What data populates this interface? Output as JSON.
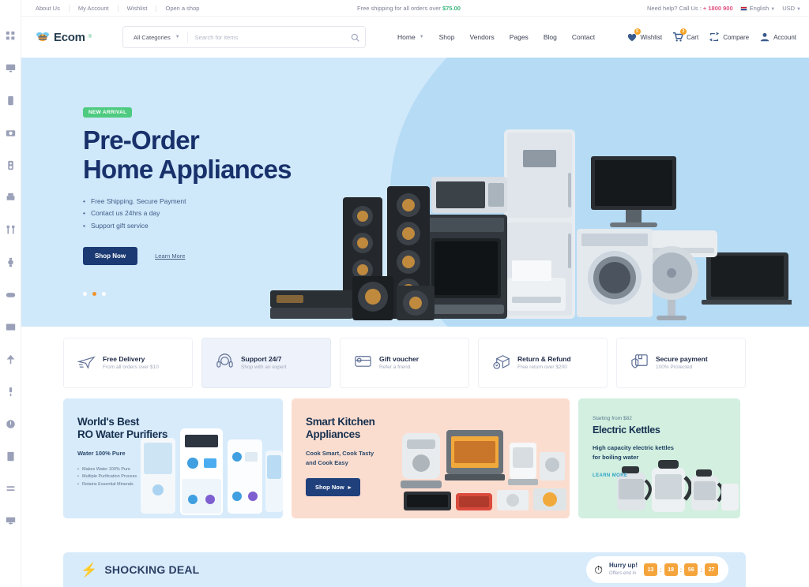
{
  "topbar": {
    "links": [
      "About Us",
      "My Account",
      "Wishlist",
      "Open a shop"
    ],
    "shipping_text": "Free shipping for all orders over ",
    "shipping_amount": "$75.00",
    "help_text": "Need help? Call Us : ",
    "phone": "+ 1800 900",
    "language": "English",
    "currency": "USD"
  },
  "header": {
    "logo_text": "Ecom",
    "logo_sup": "®",
    "search": {
      "category": "All Categories",
      "placeholder": "Search for items",
      "value": ""
    },
    "nav": [
      {
        "label": "Home",
        "has_dropdown": true
      },
      {
        "label": "Shop",
        "has_dropdown": false
      },
      {
        "label": "Vendors",
        "has_dropdown": false
      },
      {
        "label": "Pages",
        "has_dropdown": false
      },
      {
        "label": "Blog",
        "has_dropdown": false
      },
      {
        "label": "Contact",
        "has_dropdown": false
      }
    ],
    "actions": [
      {
        "label": "Wishlist",
        "badge": "5",
        "icon": "heart-icon"
      },
      {
        "label": "Cart",
        "badge": "2",
        "icon": "cart-icon"
      },
      {
        "label": "Compare",
        "badge": "",
        "icon": "compare-icon"
      },
      {
        "label": "Account",
        "badge": "",
        "icon": "user-icon"
      }
    ]
  },
  "hero": {
    "badge": "NEW ARRIVAL",
    "title_line1": "Pre-Order",
    "title_line2": "Home Appliances",
    "bullets": [
      "Free Shipping. Secure Payment",
      "Contact us 24hrs a day",
      "Support gift service"
    ],
    "shop_button": "Shop Now",
    "learn_link": "Learn More",
    "active_dot": 1,
    "dot_count": 3
  },
  "services": [
    {
      "title": "Free Delivery",
      "sub": "From all orders over $10",
      "icon": "plane-icon",
      "active": false
    },
    {
      "title": "Support 24/7",
      "sub": "Shop with an expert",
      "icon": "headset-icon",
      "active": true
    },
    {
      "title": "Gift voucher",
      "sub": "Refer a friend",
      "icon": "gift-card-icon",
      "active": false
    },
    {
      "title": "Return & Refund",
      "sub": "Free return over $200",
      "icon": "return-box-icon",
      "active": false
    },
    {
      "title": "Secure payment",
      "sub": "100% Protected",
      "icon": "shield-box-icon",
      "active": false
    }
  ],
  "promos": {
    "promo1": {
      "title_line1": "World's Best",
      "title_line2": "RO Water Purifiers",
      "sub": "Water 100% Pure",
      "bullets": [
        "Makes Water 100% Pure",
        "Multiple Purification Process",
        "Retains Essential Minerals"
      ]
    },
    "promo2": {
      "title_line1": "Smart Kitchen",
      "title_line2": "Appliances",
      "sub_line1": "Cook Smart, Cook Tasty",
      "sub_line2": "and Cook Easy",
      "button": "Shop Now"
    },
    "promo3": {
      "eyebrow": "Starting from $82",
      "title": "Electric Kettles",
      "sub_line1": "High capacity electric kettles",
      "sub_line2": "for boiling water",
      "link": "LEARN MORE"
    }
  },
  "deal": {
    "title": "SHOCKING DEAL",
    "hurry": "Hurry up!",
    "offer": "Offers end in",
    "countdown": [
      "13",
      "18",
      "56",
      "27"
    ]
  },
  "rail": {
    "icons": [
      "grid-icon",
      "monitor-icon",
      "phone-icon",
      "camera-icon",
      "speaker-icon",
      "printer-icon",
      "tools-icon",
      "watch-icon",
      "gamepad-icon",
      "tv-icon",
      "lamp-icon",
      "mic-icon",
      "clock-icon",
      "book-icon",
      "list-icon",
      "desktop-icon"
    ]
  },
  "colors": {
    "hero_bg": "#cfe8fa",
    "accent_orange": "#f5a43c",
    "accent_green": "#3bb77e",
    "navy": "#18316b",
    "promo2_bg": "#fbddd0",
    "promo3_bg": "#d2efe0"
  }
}
